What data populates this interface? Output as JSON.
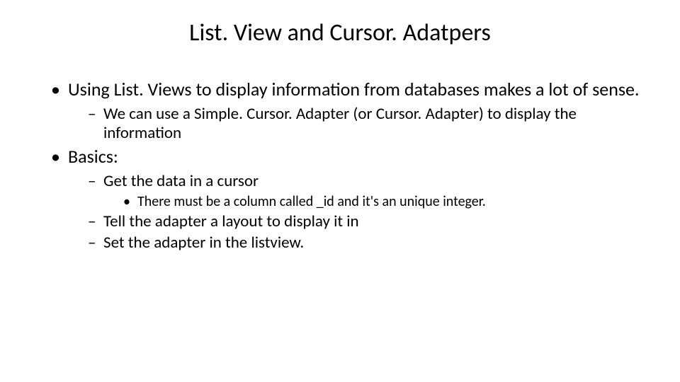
{
  "title": "List. View and Cursor. Adatpers",
  "bullets": {
    "item1": "Using List. Views to display information from databases makes a lot of sense.",
    "item1_sub1": "We can use a Simple. Cursor. Adapter (or Cursor. Adapter) to display the information",
    "item2": "Basics:",
    "item2_sub1": "Get the data in a cursor",
    "item2_sub1_sub1": "There must be a column called _id and it's an unique integer.",
    "item2_sub2": "Tell the adapter a layout to display it in",
    "item2_sub3": "Set the adapter in the listview."
  }
}
